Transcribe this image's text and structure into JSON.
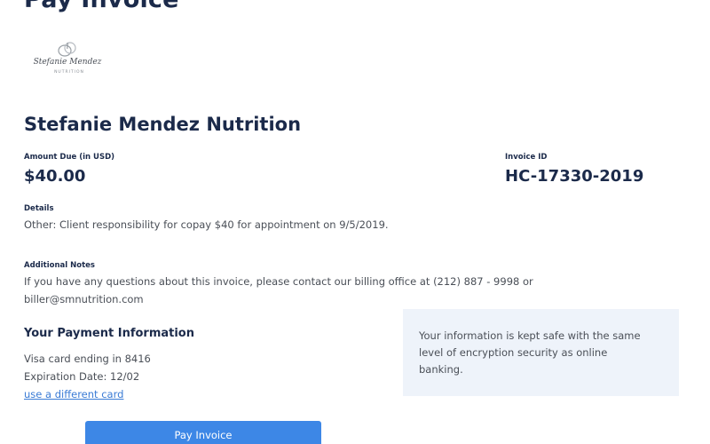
{
  "page": {
    "heading": "Pay Invoice"
  },
  "logo": {
    "script_text": "Stefanie Mendez",
    "subtext": "NUTRITION"
  },
  "invoice": {
    "company_name": "Stefanie Mendez Nutrition",
    "amount_label": "Amount Due (in USD)",
    "amount_value": "$40.00",
    "id_label": "Invoice ID",
    "id_value": "HC-17330-2019",
    "details_label": "Details",
    "details_text": "Other: Client responsibility for copay $40 for appointment on 9/5/2019.",
    "notes_label": "Additional Notes",
    "notes_line1": "If you have any questions about this invoice, please contact our billing office at (212) 887 - 9998 or",
    "notes_line2": "biller@smnutrition.com"
  },
  "payment": {
    "heading": "Your Payment Information",
    "card_text": "Visa card ending in 8416",
    "expiration_text": "Expiration Date: 12/02",
    "change_card_link": "use a different card",
    "security_note": "Your information is kept safe with the same level of encryption security as online banking.",
    "pay_button_label": "Pay Invoice"
  },
  "colors": {
    "heading_navy": "#1b2a4a",
    "link_blue": "#3a7bd5",
    "button_blue": "#3d87e6",
    "info_box_bg": "#eef3fa"
  }
}
